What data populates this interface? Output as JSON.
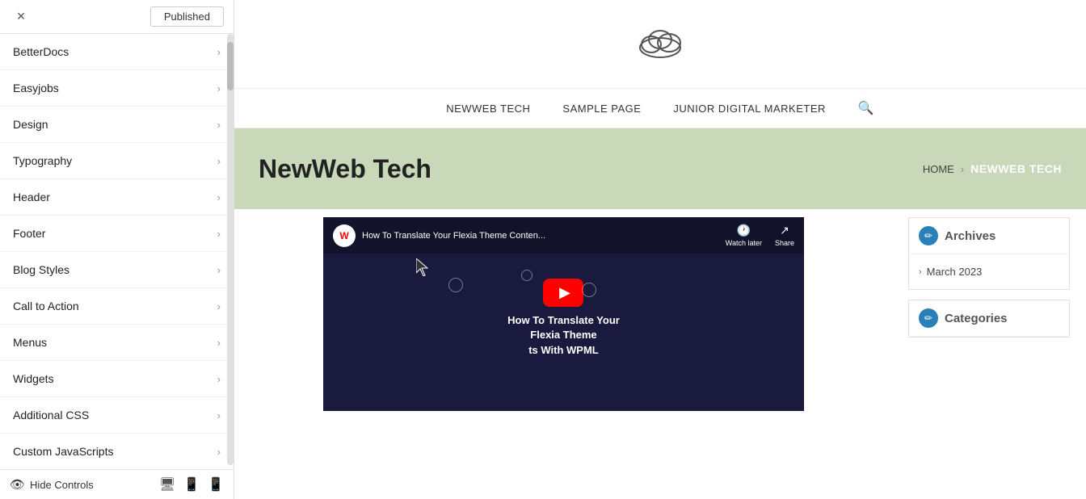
{
  "header": {
    "close_label": "×",
    "published_label": "Published"
  },
  "sidebar": {
    "items": [
      {
        "id": "betterdocs",
        "label": "BetterDocs"
      },
      {
        "id": "easyjobs",
        "label": "Easyjobs"
      },
      {
        "id": "design",
        "label": "Design"
      },
      {
        "id": "typography",
        "label": "Typography"
      },
      {
        "id": "header",
        "label": "Header"
      },
      {
        "id": "footer",
        "label": "Footer"
      },
      {
        "id": "blog-styles",
        "label": "Blog Styles"
      },
      {
        "id": "call-to-action",
        "label": "Call to Action"
      },
      {
        "id": "menus",
        "label": "Menus"
      },
      {
        "id": "widgets",
        "label": "Widgets"
      },
      {
        "id": "additional-css",
        "label": "Additional CSS"
      },
      {
        "id": "custom-javascripts",
        "label": "Custom JavaScripts"
      }
    ],
    "footer": {
      "hide_controls_label": "Hide Controls",
      "icons": [
        "desktop",
        "tablet",
        "mobile"
      ]
    }
  },
  "site": {
    "logo_symbol": "☁",
    "nav_items": [
      {
        "label": "NEWWEB TECH"
      },
      {
        "label": "SAMPLE PAGE"
      },
      {
        "label": "JUNIOR DIGITAL MARKETER"
      }
    ],
    "hero": {
      "title": "NewWeb Tech",
      "breadcrumb_home": "HOME",
      "breadcrumb_current": "NEWWEB TECH"
    },
    "youtube": {
      "logo_text": "W",
      "video_title": "How To Translate Your Flexia Theme Conten...",
      "watch_later_label": "Watch later",
      "share_label": "Share",
      "bottom_text_line1": "How To Translate Your",
      "bottom_text_line2": "Flexia Theme",
      "bottom_text_line3": "ts With WPML"
    },
    "widgets": {
      "archives": {
        "title": "Archives",
        "items": [
          "March 2023"
        ]
      },
      "categories": {
        "title": "Categories"
      }
    }
  }
}
